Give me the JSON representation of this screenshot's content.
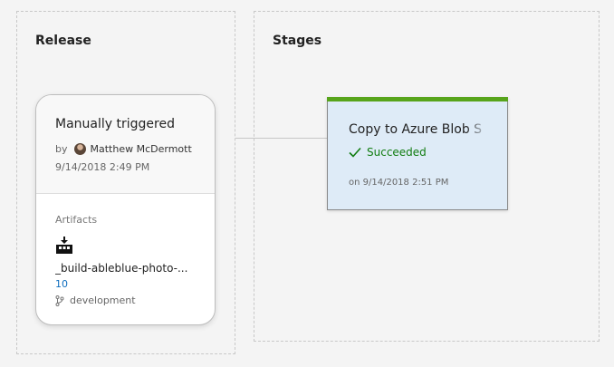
{
  "release": {
    "section_title": "Release",
    "trigger": {
      "title": "Manually triggered",
      "by_prefix": "by",
      "author": "Matthew McDermott",
      "date": "9/14/2018 2:49 PM"
    },
    "artifacts": {
      "label": "Artifacts",
      "icon": "build-icon",
      "name": "_build-ableblue-photo-...",
      "version": "10",
      "branch_icon": "branch-icon",
      "branch": "development"
    }
  },
  "stages": {
    "section_title": "Stages",
    "items": [
      {
        "name": "Copy to Azure Blob S",
        "status_icon": "check-icon",
        "status": "Succeeded",
        "date": "on 9/14/2018 2:51 PM",
        "status_color": "#57a41b",
        "background_color": "#deebf7"
      }
    ]
  },
  "colors": {
    "link": "#106ebe",
    "success": "#107c10"
  }
}
